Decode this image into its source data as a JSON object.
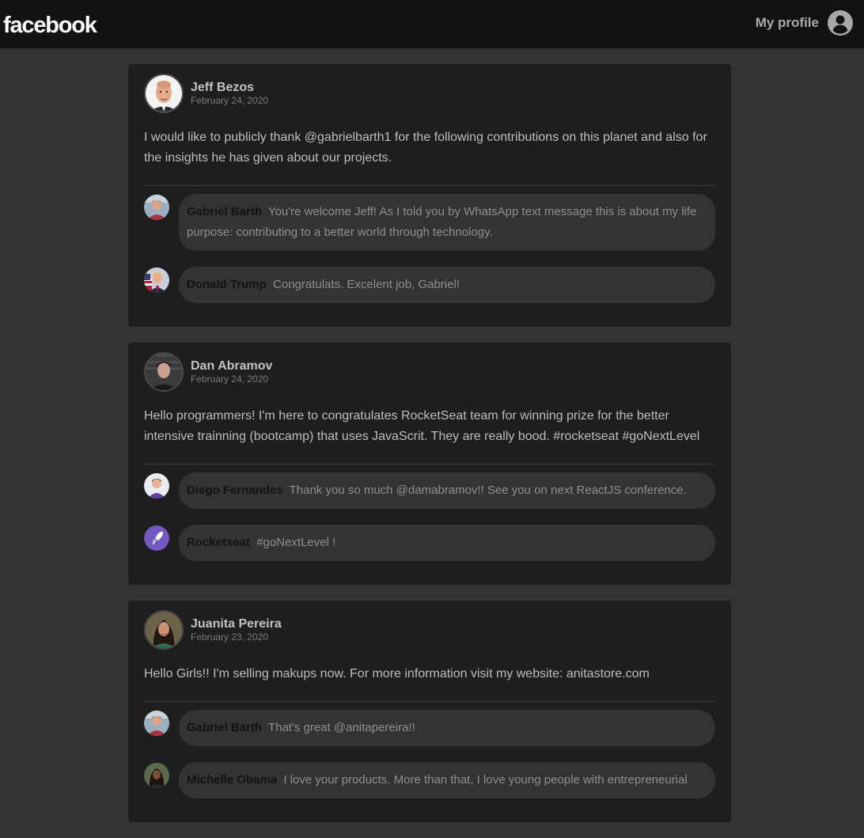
{
  "header": {
    "logo_text": "facebook",
    "profile_label": "My profile",
    "profile_icon": "user-circle-icon"
  },
  "posts": [
    {
      "author": "Jeff Bezos",
      "date": "February 24, 2020",
      "content": "I would like to publicly thank @gabrielbarth1 for the following contributions on this planet and also for the insights he has given about our projects.",
      "comments": [
        {
          "author": "Gabriel Barth",
          "content": "You're welcome Jeff! As I told you by WhatsApp text message this is about my life purpose: contributing to a better world through technology."
        },
        {
          "author": "Donald Trump",
          "content": "Congratulats. Excelent job, Gabriel!"
        }
      ]
    },
    {
      "author": "Dan Abramov",
      "date": "February 24, 2020",
      "content": "Hello programmers! I'm here to congratulates RocketSeat team for winning prize for the better intensive trainning (bootcamp) that uses JavaScrit. They are really bood. #rocketseat #goNextLevel",
      "comments": [
        {
          "author": "Diego Fernandes",
          "content": "Thank you so much @damabramov!! See you on next ReactJS conference."
        },
        {
          "author": "Rocketseat",
          "content": "#goNextLevel !"
        }
      ]
    },
    {
      "author": "Juanita Pereira",
      "date": "February 23, 2020",
      "content": "Hello Girls!! I'm selling makups now. For more information visit my website: anitastore.com",
      "comments": [
        {
          "author": "Gabriel Barth",
          "content": "That's great @anitapereira!!"
        },
        {
          "author": "Michelle Obama",
          "content": "I love your products. More than that, I love young people with entrepreneurial"
        }
      ]
    }
  ],
  "colors": {
    "page_bg": "#333333",
    "topbar_bg": "#121212",
    "card_bg": "#1e1e1e",
    "bubble_bg": "#333333",
    "rocketseat_purple": "#7159c1"
  }
}
